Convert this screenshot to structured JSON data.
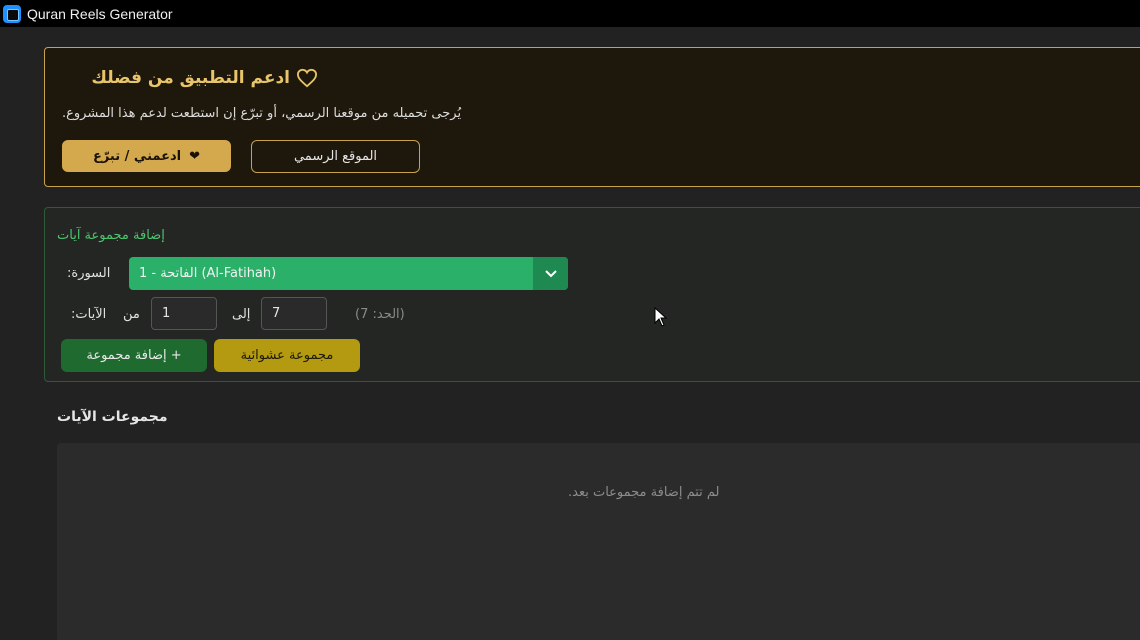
{
  "window": {
    "title": "Quran Reels Generator"
  },
  "support": {
    "title": "ادعم التطبيق من فضلك",
    "text": "يُرجى تحميله من موقعنا الرسمي، أو تبرّع إن استطعت لدعم هذا المشروع.",
    "donate_label": "ادعمني / تبرّع",
    "site_label": "الموقع الرسمي",
    "icon": "heart-icon"
  },
  "add_group": {
    "title": "إضافة مجموعة آيات",
    "surah_label": "السورة:",
    "surah_value": "1 - الفاتحة (Al-Fatihah)",
    "ayat_label": "الآيات:",
    "from_label": "من",
    "from_value": "1",
    "to_label": "إلى",
    "to_value": "7",
    "limit_text": "(الحد: 7)",
    "add_button": "إضافة مجموعة +",
    "random_button": "مجموعة عشوائية"
  },
  "groups": {
    "title": "مجموعات الآيات",
    "empty_text": "لم تتم إضافة مجموعات بعد."
  },
  "colors": {
    "accent_gold": "#d4a94e",
    "accent_green": "#2bb06a",
    "add_green": "#1f6a2f",
    "random_yellow": "#b39a10"
  }
}
